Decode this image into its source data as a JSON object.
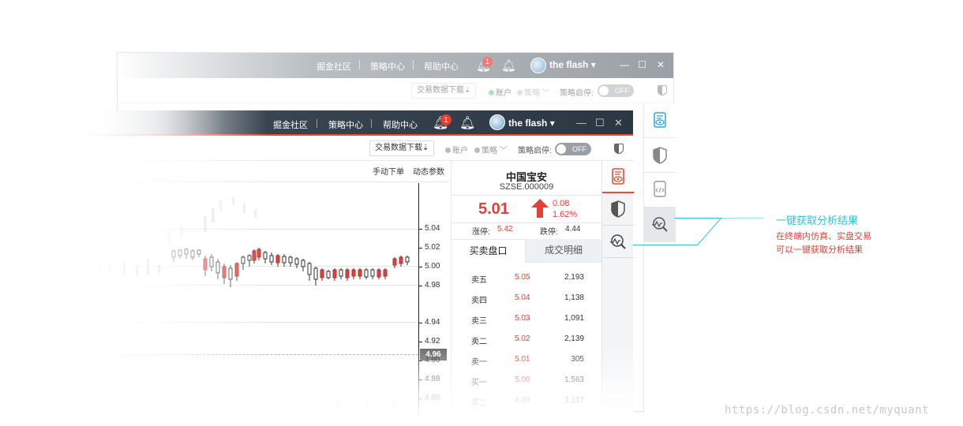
{
  "nav": {
    "community": "掘金社区",
    "strategy_center": "策略中心",
    "help_center": "帮助中心",
    "notification_count": "1",
    "username": "the flash",
    "user_caret": "▾"
  },
  "toolbar": {
    "download_button": "交易数据下载",
    "download_icon": "⇣",
    "account_label": "账户",
    "strategy_label": "策略",
    "strategy_caret": "﹀",
    "strategy_start_label": "策略启停:",
    "toggle_state": "OFF"
  },
  "chart": {
    "tabs": [
      "手动下单",
      "动态参数"
    ],
    "price_ticks": [
      "5.04",
      "5.02",
      "5.00",
      "4.98",
      "4.94",
      "4.92",
      "4.90",
      "4.88",
      "4.86"
    ],
    "current_price": "4.96"
  },
  "quote": {
    "name": "中国宝安",
    "code": "SZSE.000009",
    "last_price": "5.01",
    "change": "0.08",
    "change_pct": "1.62%",
    "limit_up_label": "涨停:",
    "limit_up_value": "5.42",
    "limit_down_label": "跌停:",
    "limit_down_value": "4.44",
    "tab_orderbook": "买卖盘口",
    "tab_trades": "成交明细",
    "orderbook": [
      {
        "name": "卖五",
        "price": "5.05",
        "volume": "2,193"
      },
      {
        "name": "卖四",
        "price": "5.04",
        "volume": "1,138"
      },
      {
        "name": "卖三",
        "price": "5.03",
        "volume": "1,091"
      },
      {
        "name": "卖二",
        "price": "5.02",
        "volume": "2,139"
      },
      {
        "name": "卖一",
        "price": "5.01",
        "volume": "305"
      },
      {
        "name": "买一",
        "price": "5.00",
        "volume": "1,563"
      },
      {
        "name": "买二",
        "price": "4.99",
        "volume": "1,117"
      }
    ]
  },
  "annotation": {
    "title": "一键获取分析结果",
    "line1": "在终端内仿真、实盘交易",
    "line2": "可以一键获取分析结果"
  },
  "watermark": "https://blog.csdn.net/myquant",
  "colors": {
    "accent_red": "#e24c3a",
    "price_up": "#e2413a",
    "callout_cyan": "#2fc4d6",
    "titlebar_dark": "#2b3743"
  },
  "icons": {
    "notification": "bell-icon",
    "avatar": "avatar-icon",
    "analysis": "magnifier-chart-icon",
    "risk": "shield-icon",
    "report": "document-eye-icon",
    "code": "document-code-icon"
  }
}
